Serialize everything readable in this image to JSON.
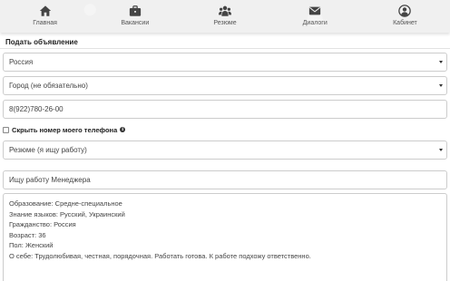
{
  "nav": {
    "items": [
      {
        "label": "Главная",
        "icon": "home-icon"
      },
      {
        "label": "Вакансии",
        "icon": "briefcase-icon"
      },
      {
        "label": "Резюме",
        "icon": "users-icon"
      },
      {
        "label": "Диалоги",
        "icon": "envelope-icon"
      },
      {
        "label": "Кабинет",
        "icon": "user-circle-icon"
      }
    ]
  },
  "form": {
    "title": "Подать объявление",
    "country_value": "Россия",
    "city_value": "Город (не обязательно)",
    "phone_value": "8(922)780-26-00",
    "hide_phone_label": "Скрыть номер моего телефона",
    "hide_phone_checked": false,
    "type_value": "Резюме (я ищу работу)",
    "headline_value": "Ищу работу Менеджера",
    "description_lines": [
      "Образование: Средне-специальное",
      "Знание языков: Русский, Украинский",
      "Гражданство: Россия",
      "Возраст: 36",
      "Пол: Женский",
      "О себе: Трудолюбивая, честная, порядочная. Работать готова. К работе подхожу ответственно."
    ]
  }
}
